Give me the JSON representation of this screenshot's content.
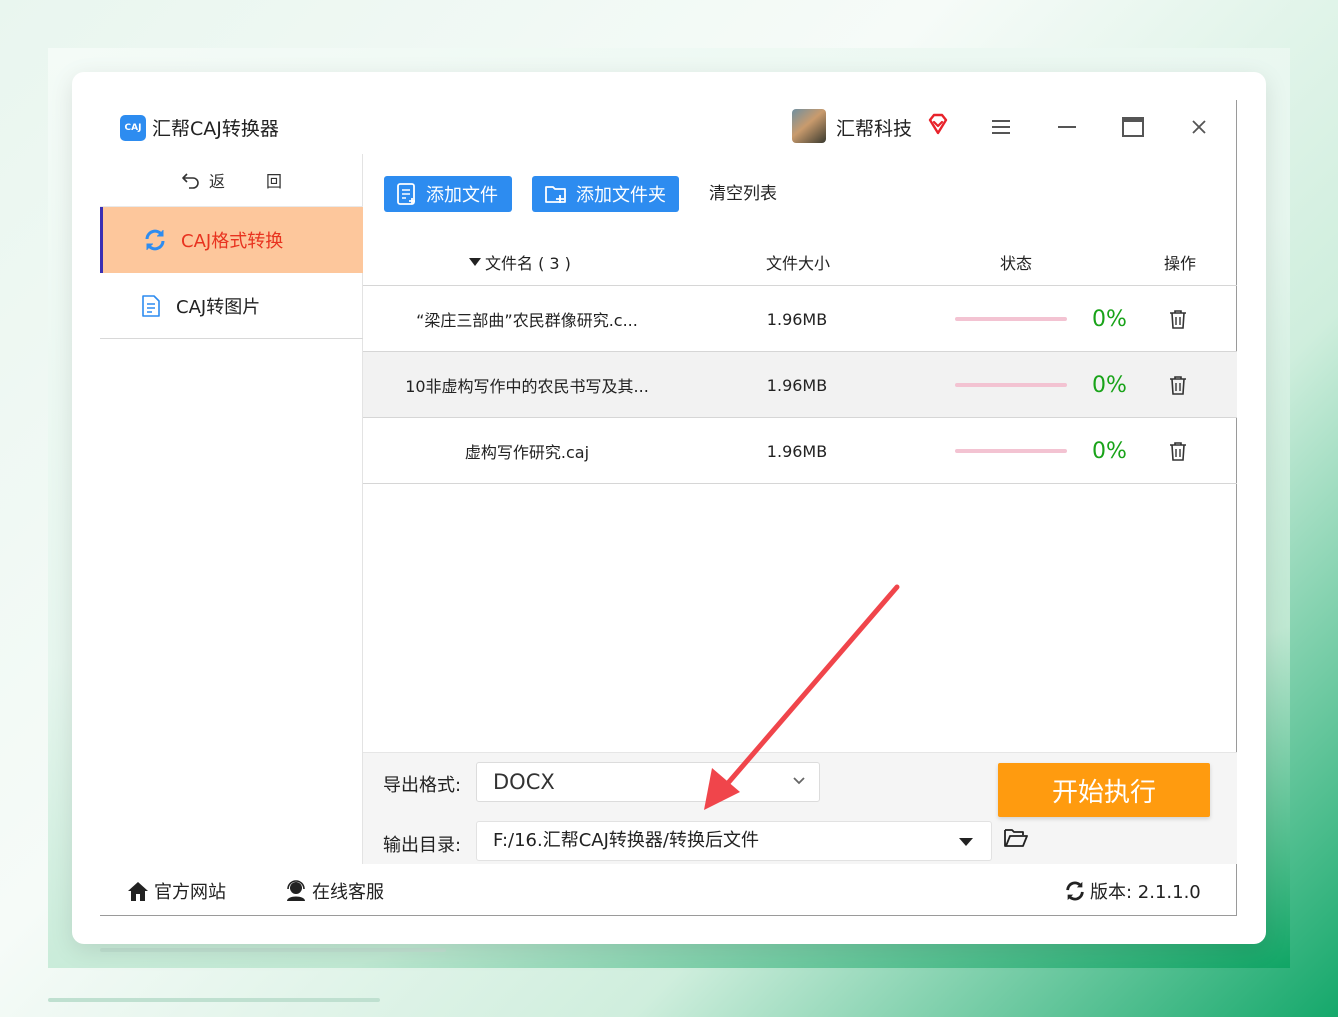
{
  "app": {
    "title": "汇帮CAJ转换器",
    "logo_text": "CAJ"
  },
  "user": {
    "name": "汇帮科技"
  },
  "sidebar": {
    "back_label": "返 回",
    "items": [
      {
        "label": "CAJ格式转换",
        "active": true
      },
      {
        "label": "CAJ转图片",
        "active": false
      }
    ]
  },
  "toolbar": {
    "add_file": "添加文件",
    "add_folder": "添加文件夹",
    "clear_list": "清空列表"
  },
  "table": {
    "headers": {
      "name": "文件名 ( 3 )",
      "size": "文件大小",
      "status": "状态",
      "op": "操作"
    },
    "rows": [
      {
        "name": "“梁庄三部曲”农民群像研究.c...",
        "size": "1.96MB",
        "progress": "0%"
      },
      {
        "name": "10非虚构写作中的农民书写及其...",
        "size": "1.96MB",
        "progress": "0%"
      },
      {
        "name": "虚构写作研究.caj",
        "size": "1.96MB",
        "progress": "0%"
      }
    ]
  },
  "options": {
    "format_label": "导出格式:",
    "format_value": "DOCX",
    "output_label": "输出目录:",
    "output_value": "F:/16.汇帮CAJ转换器/转换后文件"
  },
  "start_button": "开始执行",
  "footer": {
    "website": "官方网站",
    "service": "在线客服",
    "version": "版本:  2.1.1.0"
  },
  "colors": {
    "primary_blue": "#2d8cf0",
    "active_nav_bg": "#fdc79c",
    "active_nav_text": "#e8331f",
    "start_orange": "#ff9b0f",
    "progress_green": "#19a319",
    "annotation_arrow": "#f0454b"
  }
}
